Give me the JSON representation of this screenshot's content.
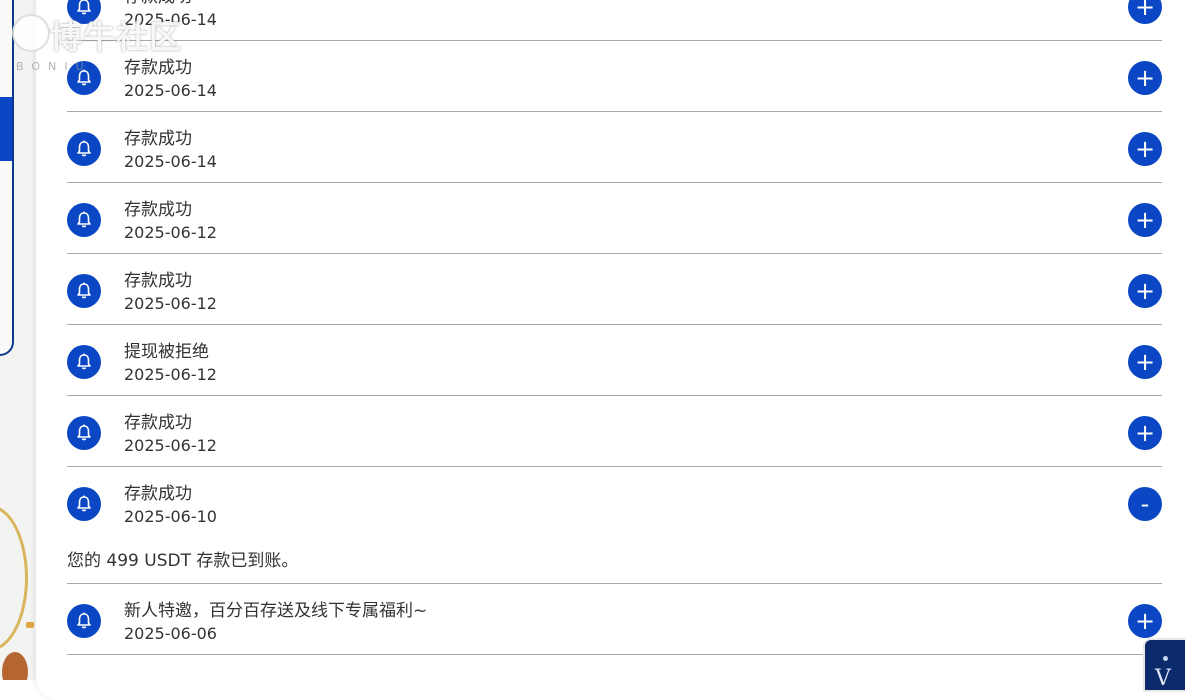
{
  "watermark": {
    "brand": "博牛社区",
    "sub": "BONIU"
  },
  "notifications": [
    {
      "title": "存款成功",
      "date": "2025-06-14",
      "toggle": "+"
    },
    {
      "title": "存款成功",
      "date": "2025-06-14",
      "toggle": "+"
    },
    {
      "title": "存款成功",
      "date": "2025-06-14",
      "toggle": "+"
    },
    {
      "title": "存款成功",
      "date": "2025-06-12",
      "toggle": "+"
    },
    {
      "title": "存款成功",
      "date": "2025-06-12",
      "toggle": "+"
    },
    {
      "title": "提现被拒绝",
      "date": "2025-06-12",
      "toggle": "+"
    },
    {
      "title": "存款成功",
      "date": "2025-06-12",
      "toggle": "+"
    },
    {
      "title": "存款成功",
      "date": "2025-06-10",
      "toggle": "-",
      "detail": "您的 499 USDT 存款已到账。"
    },
    {
      "title": "新人特邀，百分百存送及线下专属福利~",
      "date": "2025-06-06",
      "toggle": "+"
    }
  ],
  "icons": {
    "row_icon": "bell-icon",
    "expand_icon": "plus-icon",
    "collapse_icon": "minus-icon"
  },
  "colors": {
    "accent": "#0b47c4",
    "divider": "#a9a9a9",
    "text": "#333333"
  }
}
